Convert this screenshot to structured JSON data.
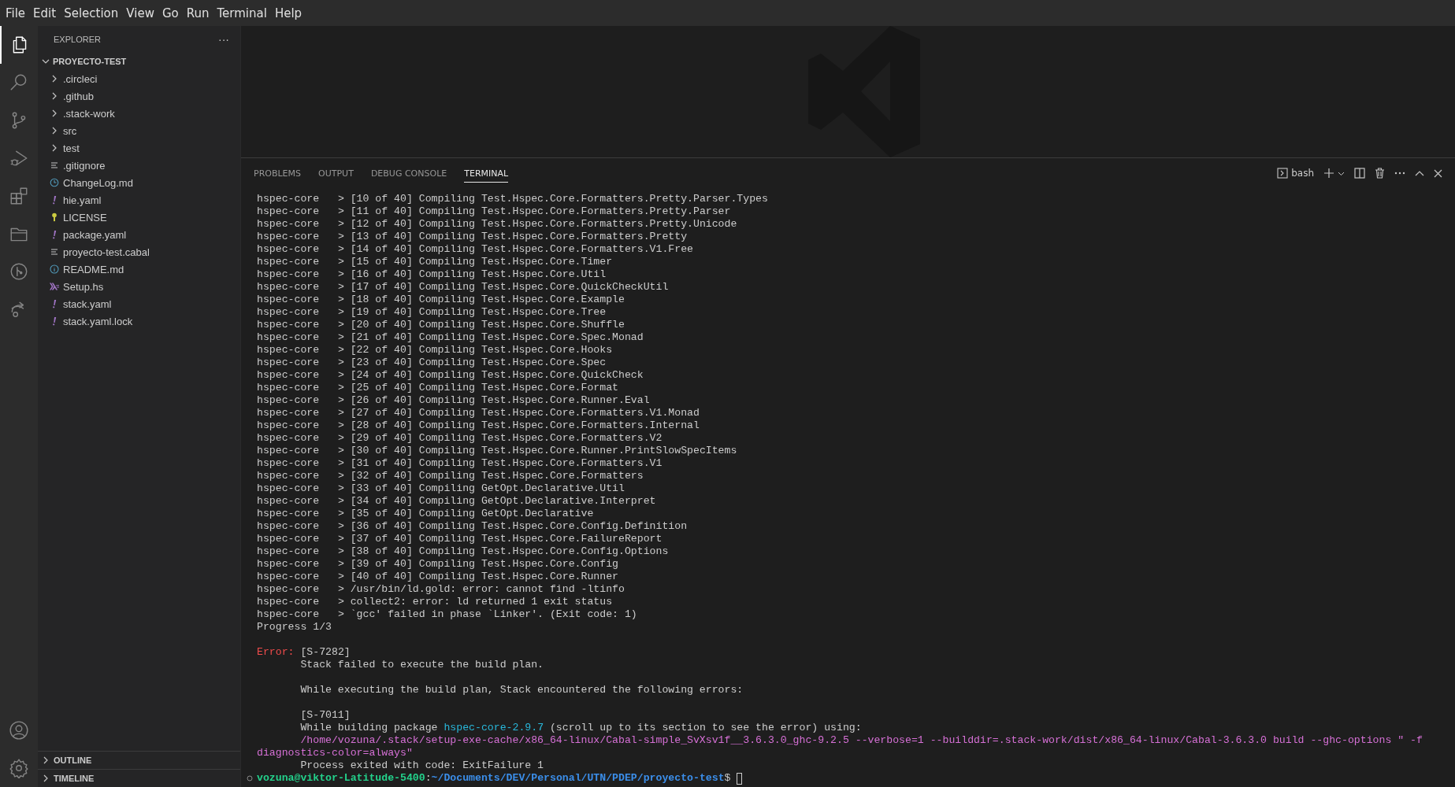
{
  "menu": [
    "File",
    "Edit",
    "Selection",
    "View",
    "Go",
    "Run",
    "Terminal",
    "Help"
  ],
  "activity_bar": {
    "top": [
      {
        "kind": "files",
        "selected": true
      },
      {
        "kind": "search",
        "selected": false
      },
      {
        "kind": "source-control",
        "selected": false
      },
      {
        "kind": "run-debug",
        "selected": false
      },
      {
        "kind": "extensions",
        "selected": false
      },
      {
        "kind": "folder",
        "selected": false
      },
      {
        "kind": "git-graph",
        "selected": false
      },
      {
        "kind": "remote",
        "selected": false
      }
    ],
    "bottom": [
      {
        "kind": "account",
        "selected": false
      },
      {
        "kind": "settings",
        "selected": false
      }
    ]
  },
  "sidebar": {
    "title": "EXPLORER",
    "more": "···",
    "root": {
      "label": "PROYECTO-TEST",
      "expanded": true,
      "children": [
        {
          "label": ".circleci",
          "kind": "folder",
          "expanded": false
        },
        {
          "label": ".github",
          "kind": "folder",
          "expanded": false
        },
        {
          "label": ".stack-work",
          "kind": "folder",
          "expanded": false
        },
        {
          "label": "src",
          "kind": "folder",
          "expanded": false
        },
        {
          "label": "test",
          "kind": "folder",
          "expanded": false
        },
        {
          "label": ".gitignore",
          "kind": "text"
        },
        {
          "label": "ChangeLog.md",
          "kind": "changelog"
        },
        {
          "label": "hie.yaml",
          "kind": "yaml"
        },
        {
          "label": "LICENSE",
          "kind": "license"
        },
        {
          "label": "package.yaml",
          "kind": "yaml"
        },
        {
          "label": "proyecto-test.cabal",
          "kind": "text"
        },
        {
          "label": "README.md",
          "kind": "readme"
        },
        {
          "label": "Setup.hs",
          "kind": "haskell"
        },
        {
          "label": "stack.yaml",
          "kind": "yaml"
        },
        {
          "label": "stack.yaml.lock",
          "kind": "yaml"
        }
      ]
    },
    "sections": [
      {
        "label": "OUTLINE",
        "expanded": false
      },
      {
        "label": "TIMELINE",
        "expanded": false
      }
    ]
  },
  "panel": {
    "tabs": [
      {
        "label": "PROBLEMS",
        "selected": false
      },
      {
        "label": "OUTPUT",
        "selected": false
      },
      {
        "label": "DEBUG CONSOLE",
        "selected": false
      },
      {
        "label": "TERMINAL",
        "selected": true
      }
    ],
    "terminal_name": "bash",
    "lines": [
      {
        "segments": [
          {
            "kind": "text",
            "text": "hspec-core   > [10 of 40] Compiling Test.Hspec.Core.Formatters.Pretty.Parser.Types"
          }
        ]
      },
      {
        "segments": [
          {
            "kind": "text",
            "text": "hspec-core   > [11 of 40] Compiling Test.Hspec.Core.Formatters.Pretty.Parser"
          }
        ]
      },
      {
        "segments": [
          {
            "kind": "text",
            "text": "hspec-core   > [12 of 40] Compiling Test.Hspec.Core.Formatters.Pretty.Unicode"
          }
        ]
      },
      {
        "segments": [
          {
            "kind": "text",
            "text": "hspec-core   > [13 of 40] Compiling Test.Hspec.Core.Formatters.Pretty"
          }
        ]
      },
      {
        "segments": [
          {
            "kind": "text",
            "text": "hspec-core   > [14 of 40] Compiling Test.Hspec.Core.Formatters.V1.Free"
          }
        ]
      },
      {
        "segments": [
          {
            "kind": "text",
            "text": "hspec-core   > [15 of 40] Compiling Test.Hspec.Core.Timer"
          }
        ]
      },
      {
        "segments": [
          {
            "kind": "text",
            "text": "hspec-core   > [16 of 40] Compiling Test.Hspec.Core.Util"
          }
        ]
      },
      {
        "segments": [
          {
            "kind": "text",
            "text": "hspec-core   > [17 of 40] Compiling Test.Hspec.Core.QuickCheckUtil"
          }
        ]
      },
      {
        "segments": [
          {
            "kind": "text",
            "text": "hspec-core   > [18 of 40] Compiling Test.Hspec.Core.Example"
          }
        ]
      },
      {
        "segments": [
          {
            "kind": "text",
            "text": "hspec-core   > [19 of 40] Compiling Test.Hspec.Core.Tree"
          }
        ]
      },
      {
        "segments": [
          {
            "kind": "text",
            "text": "hspec-core   > [20 of 40] Compiling Test.Hspec.Core.Shuffle"
          }
        ]
      },
      {
        "segments": [
          {
            "kind": "text",
            "text": "hspec-core   > [21 of 40] Compiling Test.Hspec.Core.Spec.Monad"
          }
        ]
      },
      {
        "segments": [
          {
            "kind": "text",
            "text": "hspec-core   > [22 of 40] Compiling Test.Hspec.Core.Hooks"
          }
        ]
      },
      {
        "segments": [
          {
            "kind": "text",
            "text": "hspec-core   > [23 of 40] Compiling Test.Hspec.Core.Spec"
          }
        ]
      },
      {
        "segments": [
          {
            "kind": "text",
            "text": "hspec-core   > [24 of 40] Compiling Test.Hspec.Core.QuickCheck"
          }
        ]
      },
      {
        "segments": [
          {
            "kind": "text",
            "text": "hspec-core   > [25 of 40] Compiling Test.Hspec.Core.Format"
          }
        ]
      },
      {
        "segments": [
          {
            "kind": "text",
            "text": "hspec-core   > [26 of 40] Compiling Test.Hspec.Core.Runner.Eval"
          }
        ]
      },
      {
        "segments": [
          {
            "kind": "text",
            "text": "hspec-core   > [27 of 40] Compiling Test.Hspec.Core.Formatters.V1.Monad"
          }
        ]
      },
      {
        "segments": [
          {
            "kind": "text",
            "text": "hspec-core   > [28 of 40] Compiling Test.Hspec.Core.Formatters.Internal"
          }
        ]
      },
      {
        "segments": [
          {
            "kind": "text",
            "text": "hspec-core   > [29 of 40] Compiling Test.Hspec.Core.Formatters.V2"
          }
        ]
      },
      {
        "segments": [
          {
            "kind": "text",
            "text": "hspec-core   > [30 of 40] Compiling Test.Hspec.Core.Runner.PrintSlowSpecItems"
          }
        ]
      },
      {
        "segments": [
          {
            "kind": "text",
            "text": "hspec-core   > [31 of 40] Compiling Test.Hspec.Core.Formatters.V1"
          }
        ]
      },
      {
        "segments": [
          {
            "kind": "text",
            "text": "hspec-core   > [32 of 40] Compiling Test.Hspec.Core.Formatters"
          }
        ]
      },
      {
        "segments": [
          {
            "kind": "text",
            "text": "hspec-core   > [33 of 40] Compiling GetOpt.Declarative.Util"
          }
        ]
      },
      {
        "segments": [
          {
            "kind": "text",
            "text": "hspec-core   > [34 of 40] Compiling GetOpt.Declarative.Interpret"
          }
        ]
      },
      {
        "segments": [
          {
            "kind": "text",
            "text": "hspec-core   > [35 of 40] Compiling GetOpt.Declarative"
          }
        ]
      },
      {
        "segments": [
          {
            "kind": "text",
            "text": "hspec-core   > [36 of 40] Compiling Test.Hspec.Core.Config.Definition"
          }
        ]
      },
      {
        "segments": [
          {
            "kind": "text",
            "text": "hspec-core   > [37 of 40] Compiling Test.Hspec.Core.FailureReport"
          }
        ]
      },
      {
        "segments": [
          {
            "kind": "text",
            "text": "hspec-core   > [38 of 40] Compiling Test.Hspec.Core.Config.Options"
          }
        ]
      },
      {
        "segments": [
          {
            "kind": "text",
            "text": "hspec-core   > [39 of 40] Compiling Test.Hspec.Core.Config"
          }
        ]
      },
      {
        "segments": [
          {
            "kind": "text",
            "text": "hspec-core   > [40 of 40] Compiling Test.Hspec.Core.Runner"
          }
        ]
      },
      {
        "segments": [
          {
            "kind": "text",
            "text": "hspec-core   > /usr/bin/ld.gold: error: cannot find -ltinfo"
          }
        ]
      },
      {
        "segments": [
          {
            "kind": "text",
            "text": "hspec-core   > collect2: error: ld returned 1 exit status"
          }
        ]
      },
      {
        "segments": [
          {
            "kind": "text",
            "text": "hspec-core   > `gcc' failed in phase `Linker'. (Exit code: 1)"
          }
        ]
      },
      {
        "segments": [
          {
            "kind": "text",
            "text": "Progress 1/3"
          }
        ]
      },
      {
        "kind": "blank"
      },
      {
        "segments": [
          {
            "kind": "error-label",
            "text": "Error:"
          },
          {
            "kind": "text",
            "text": " [S-7282]"
          }
        ]
      },
      {
        "indent": true,
        "segments": [
          {
            "kind": "text",
            "text": "Stack failed to execute the build plan."
          }
        ]
      },
      {
        "kind": "blank"
      },
      {
        "indent": true,
        "segments": [
          {
            "kind": "text",
            "text": "While executing the build plan, Stack encountered the following errors:"
          }
        ]
      },
      {
        "kind": "blank"
      },
      {
        "indent": true,
        "segments": [
          {
            "kind": "text",
            "text": "[S-7011]"
          }
        ]
      },
      {
        "indent": true,
        "segments": [
          {
            "kind": "text",
            "text": "While building package "
          },
          {
            "kind": "package",
            "text": "hspec-core-2.9.7"
          },
          {
            "kind": "text",
            "text": " (scroll up to its section to see the error) using:"
          }
        ]
      },
      {
        "indent": true,
        "segments": [
          {
            "kind": "command",
            "text": "/home/vozuna/.stack/setup-exe-cache/x86_64-linux/Cabal-simple_SvXsv1f__3.6.3.0_ghc-9.2.5 --verbose=1 --builddir=.stack-work/dist/x86_64-linux/Cabal-3.6.3.0 build --ghc-options \" -f"
          }
        ]
      },
      {
        "segments": [
          {
            "kind": "command",
            "text": "diagnostics-color=always\""
          }
        ]
      },
      {
        "indent": true,
        "segments": [
          {
            "kind": "text",
            "text": "Process exited with code: ExitFailure 1"
          }
        ]
      },
      {
        "kind": "prompt",
        "segments": [
          {
            "kind": "user",
            "text": "vozuna@viktor-Latitude-5400"
          },
          {
            "kind": "text",
            "text": ":"
          },
          {
            "kind": "path",
            "text": "~/Documents/DEV/Personal/UTN/PDEP/proyecto-test"
          },
          {
            "kind": "text",
            "text": "$"
          }
        ]
      }
    ]
  }
}
